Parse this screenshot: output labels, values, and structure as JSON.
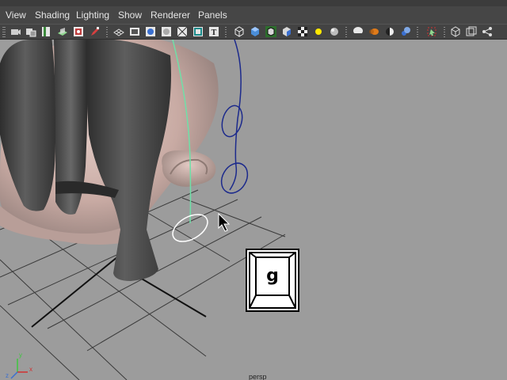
{
  "menubar": {
    "items": [
      "View",
      "Shading",
      "Lighting",
      "Show",
      "Renderer",
      "Panels"
    ]
  },
  "toolbar": {
    "icons": [
      "select-camera-icon",
      "camera-attributes-icon",
      "bookmark-icon",
      "image-plane-icon",
      "two-d-pan-icon",
      "grease-pencil-icon",
      "grid-icon",
      "film-gate-icon",
      "resolution-gate-icon",
      "gate-mask-icon",
      "field-chart-icon",
      "safe-action-icon",
      "safe-title-icon",
      "wireframe-icon",
      "smooth-shade-icon",
      "wireframe-on-shaded-icon",
      "default-material-icon",
      "textured-icon",
      "use-all-lights-icon",
      "shadows-icon",
      "screen-space-ao-icon",
      "motion-blur-icon",
      "multisample-aa-icon",
      "depth-of-field-icon",
      "isolate-select-icon",
      "xray-icon",
      "xray-joints-icon",
      "xray-components-icon"
    ]
  },
  "viewport": {
    "hotkey": "g",
    "camera_label": "persp",
    "axis": {
      "x": "x",
      "y": "y",
      "z": "z"
    },
    "colors": {
      "background": "#9c9c9c",
      "grid": "#3a3a3a",
      "hair": "#4a4a4a",
      "skin": "#d4b7b0",
      "curve_blue": "#1c2a8c",
      "curve_green": "#6fe0a8",
      "circle_white": "#ffffff"
    }
  }
}
